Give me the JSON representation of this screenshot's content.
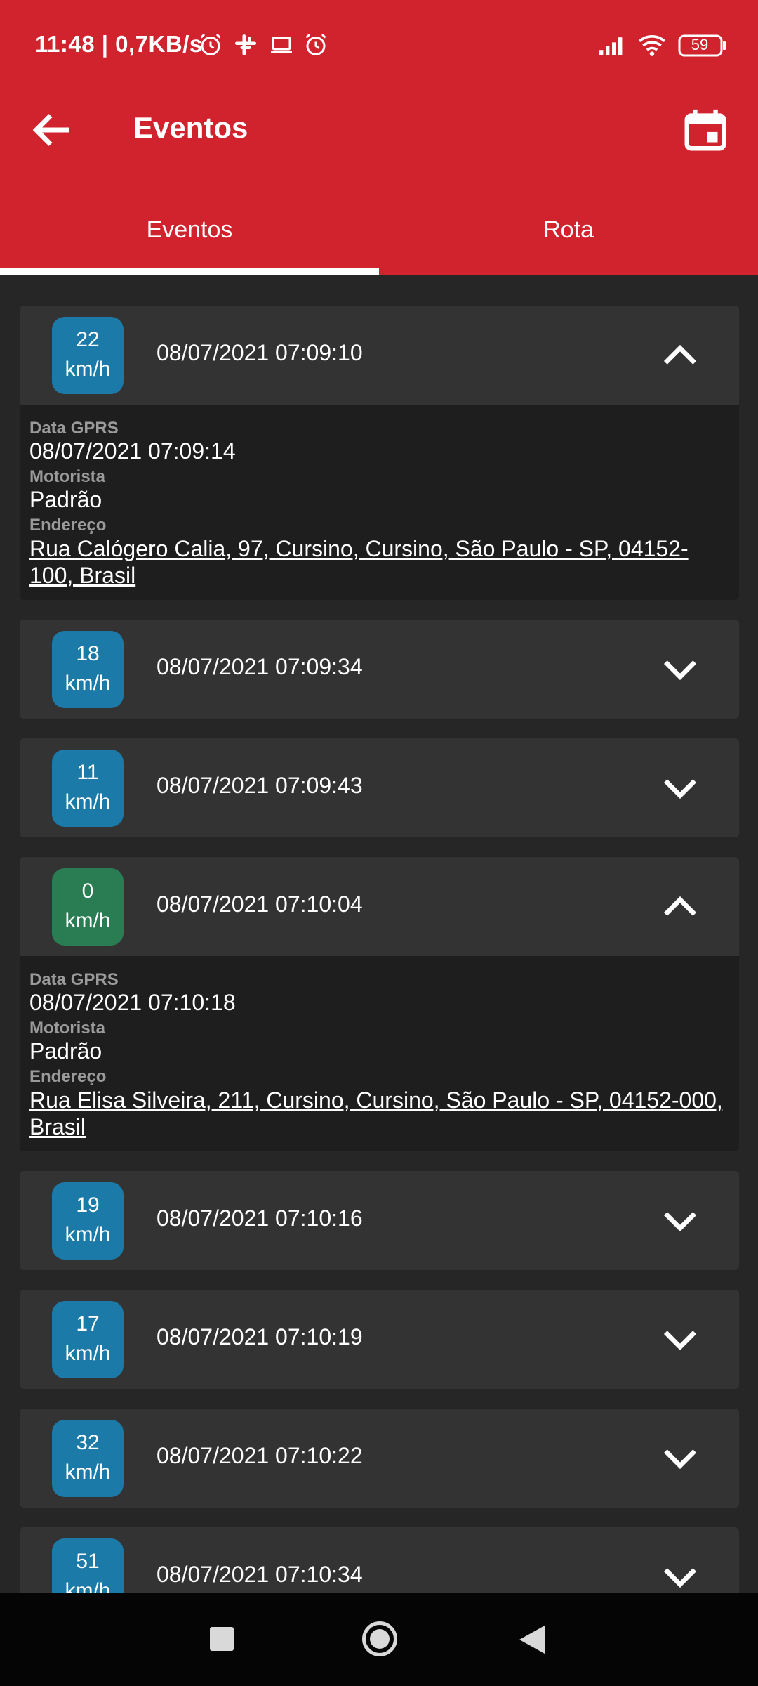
{
  "status_bar": {
    "text": "11:48 | 0,7KB/s",
    "battery": "59",
    "icons": [
      "alarm-icon",
      "slack-icon",
      "laptop-icon",
      "alarm-icon",
      "signal-icon",
      "wifi-icon",
      "battery-icon"
    ]
  },
  "app_bar": {
    "title": "Eventos",
    "back_icon": "arrow-left-icon",
    "action_icon": "calendar-icon"
  },
  "tabs": [
    {
      "label": "Eventos",
      "selected": true
    },
    {
      "label": "Rota",
      "selected": false
    }
  ],
  "colors": {
    "primary": "#d0232e",
    "speed_moving": "#1c7aa8",
    "speed_stopped": "#2a7d52",
    "card": "#333333",
    "card_detail": "#1e1e1e",
    "background": "#262626"
  },
  "detail_labels": {
    "gprs": "Data GPRS",
    "driver": "Motorista",
    "address": "Endereço"
  },
  "events": [
    {
      "speed": "22",
      "unit": "km/h",
      "timestamp": "08/07/2021 07:09:10",
      "expanded": true,
      "gprs_date": "08/07/2021 07:09:14",
      "driver": "Padrão",
      "address": "Rua Calógero Calia, 97, Cursino, Cursino, São Paulo - SP, 04152-100, Brasil"
    },
    {
      "speed": "18",
      "unit": "km/h",
      "timestamp": "08/07/2021 07:09:34",
      "expanded": false
    },
    {
      "speed": "11",
      "unit": "km/h",
      "timestamp": "08/07/2021 07:09:43",
      "expanded": false
    },
    {
      "speed": "0",
      "unit": "km/h",
      "timestamp": "08/07/2021 07:10:04",
      "expanded": true,
      "gprs_date": "08/07/2021 07:10:18",
      "driver": "Padrão",
      "address": "Rua Elisa Silveira, 211, Cursino, Cursino, São Paulo - SP, 04152-000, Brasil"
    },
    {
      "speed": "19",
      "unit": "km/h",
      "timestamp": "08/07/2021 07:10:16",
      "expanded": false
    },
    {
      "speed": "17",
      "unit": "km/h",
      "timestamp": "08/07/2021 07:10:19",
      "expanded": false
    },
    {
      "speed": "32",
      "unit": "km/h",
      "timestamp": "08/07/2021 07:10:22",
      "expanded": false
    },
    {
      "speed": "51",
      "unit": "km/h",
      "timestamp": "08/07/2021 07:10:34",
      "expanded": false
    }
  ],
  "nav_bar": [
    "recents-button",
    "home-button",
    "back-button"
  ]
}
